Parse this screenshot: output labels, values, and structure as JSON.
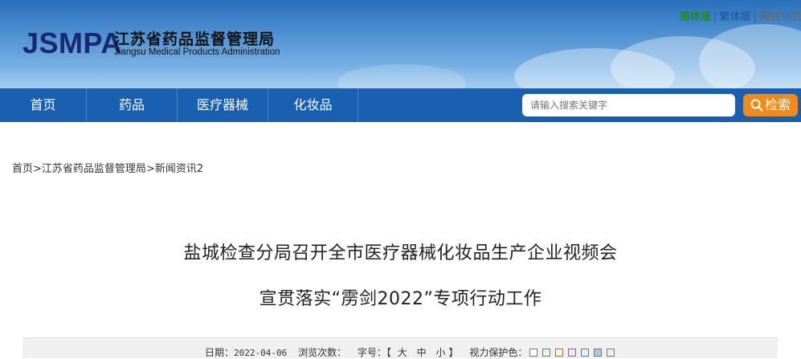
{
  "header": {
    "logo_abbr": "JSMPA",
    "org_name_cn": "江苏省药品监督管理局",
    "org_name_en": "Jiangsu Medical Products Administration",
    "top_links": {
      "simplified": "简体版",
      "traditional": "繁体版",
      "separator": "|",
      "site_nav": "网站导航"
    }
  },
  "nav": {
    "items": [
      {
        "label": "首页"
      },
      {
        "label": "药品"
      },
      {
        "label": "医疗器械"
      },
      {
        "label": "化妆品"
      }
    ],
    "search_placeholder": "请输入搜索关键字",
    "search_button": "检索"
  },
  "breadcrumb": {
    "home": "首页",
    "sep": ">",
    "level1": "江苏省药品监督管理局",
    "level2": "新闻资讯2"
  },
  "article": {
    "title_line1": "盐城检查分局召开全市医疗器械化妆品生产企业视频会",
    "title_line2": "宣贯落实“雳剑2022”专项行动工作"
  },
  "infobar": {
    "date_label": "日期：",
    "date_value": "2022-04-06",
    "views_label": "浏览次数：",
    "font_label": "字号：【",
    "font_large": "大",
    "font_medium": "中",
    "font_small": "小",
    "font_close": "】",
    "eye_label": "视力保护色：",
    "swatches": [
      "#ffffff",
      "#e8f7e4",
      "#fbf5d6",
      "#f8e1f2",
      "#dff0f7",
      "#a9c8ea",
      "#eeeeee"
    ]
  },
  "colors": {
    "nav_bg": "#1a60b0",
    "search_button_bg": "#f08a1a",
    "simplified_link": "#1f8a2a"
  }
}
